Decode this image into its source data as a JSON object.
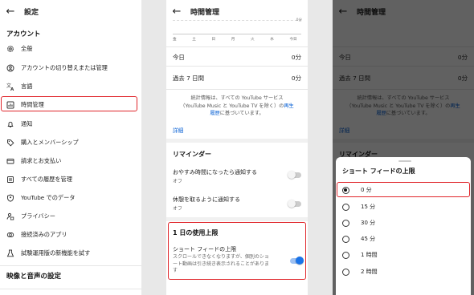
{
  "settings_panel": {
    "title": "設定",
    "section_account": "アカウント",
    "items": [
      {
        "label": "全般",
        "icon": "gear-icon"
      },
      {
        "label": "アカウントの切り替えまたは管理",
        "icon": "switch-account-icon"
      },
      {
        "label": "言語",
        "icon": "language-icon"
      },
      {
        "label": "時間管理",
        "icon": "time-chart-icon"
      },
      {
        "label": "通知",
        "icon": "bell-icon"
      },
      {
        "label": "購入とメンバーシップ",
        "icon": "tag-icon"
      },
      {
        "label": "請求とお支払い",
        "icon": "card-icon"
      },
      {
        "label": "すべての履歴を管理",
        "icon": "history-icon"
      },
      {
        "label": "YouTube でのデータ",
        "icon": "shield-person-icon"
      },
      {
        "label": "プライバシー",
        "icon": "lock-person-icon"
      },
      {
        "label": "接続済みのアプリ",
        "icon": "link-icon"
      },
      {
        "label": "試験運用版の新機能を試す",
        "icon": "flask-icon"
      }
    ],
    "section_video": "映像と音声の設定"
  },
  "time_panel": {
    "title": "時間管理",
    "chart_max_label": "0分",
    "days": [
      "金",
      "土",
      "日",
      "月",
      "火",
      "水",
      "今日"
    ],
    "today_label": "今日",
    "today_value": "0分",
    "week_label": "過去 7 日間",
    "week_value": "0分",
    "stats_text_1": "統計情報は、すべての YouTube サービス",
    "stats_text_2": "（YouTube Music と YouTube TV を除く）の",
    "stats_link_1": "再生",
    "stats_link_2": "履歴",
    "stats_text_3": "に基づいています。",
    "details_link": "詳細",
    "reminder_heading": "リマインダー",
    "bedtime_label": "おやすみ時間になったら通知する",
    "bedtime_state": "オフ",
    "break_label": "休憩を取るように通知する",
    "break_state": "オフ",
    "daily_limit_heading": "1 日の使用上限",
    "shorts_limit_label": "ショート フィードの上限",
    "shorts_limit_desc_1": "スクロールできなくなりますが、個別のショ",
    "shorts_limit_desc_2": "ート動画は引き続き表示されることがありま",
    "shorts_limit_desc_3": "す"
  },
  "limit_sheet": {
    "title": "ショート フィードの上限",
    "options": [
      "0 分",
      "15 分",
      "30 分",
      "45 分",
      "1 時間",
      "2 時間"
    ],
    "selected": "0 分"
  },
  "colors": {
    "highlight": "#e0262b",
    "link": "#065fd4",
    "toggle_on": "#1a73e8"
  }
}
